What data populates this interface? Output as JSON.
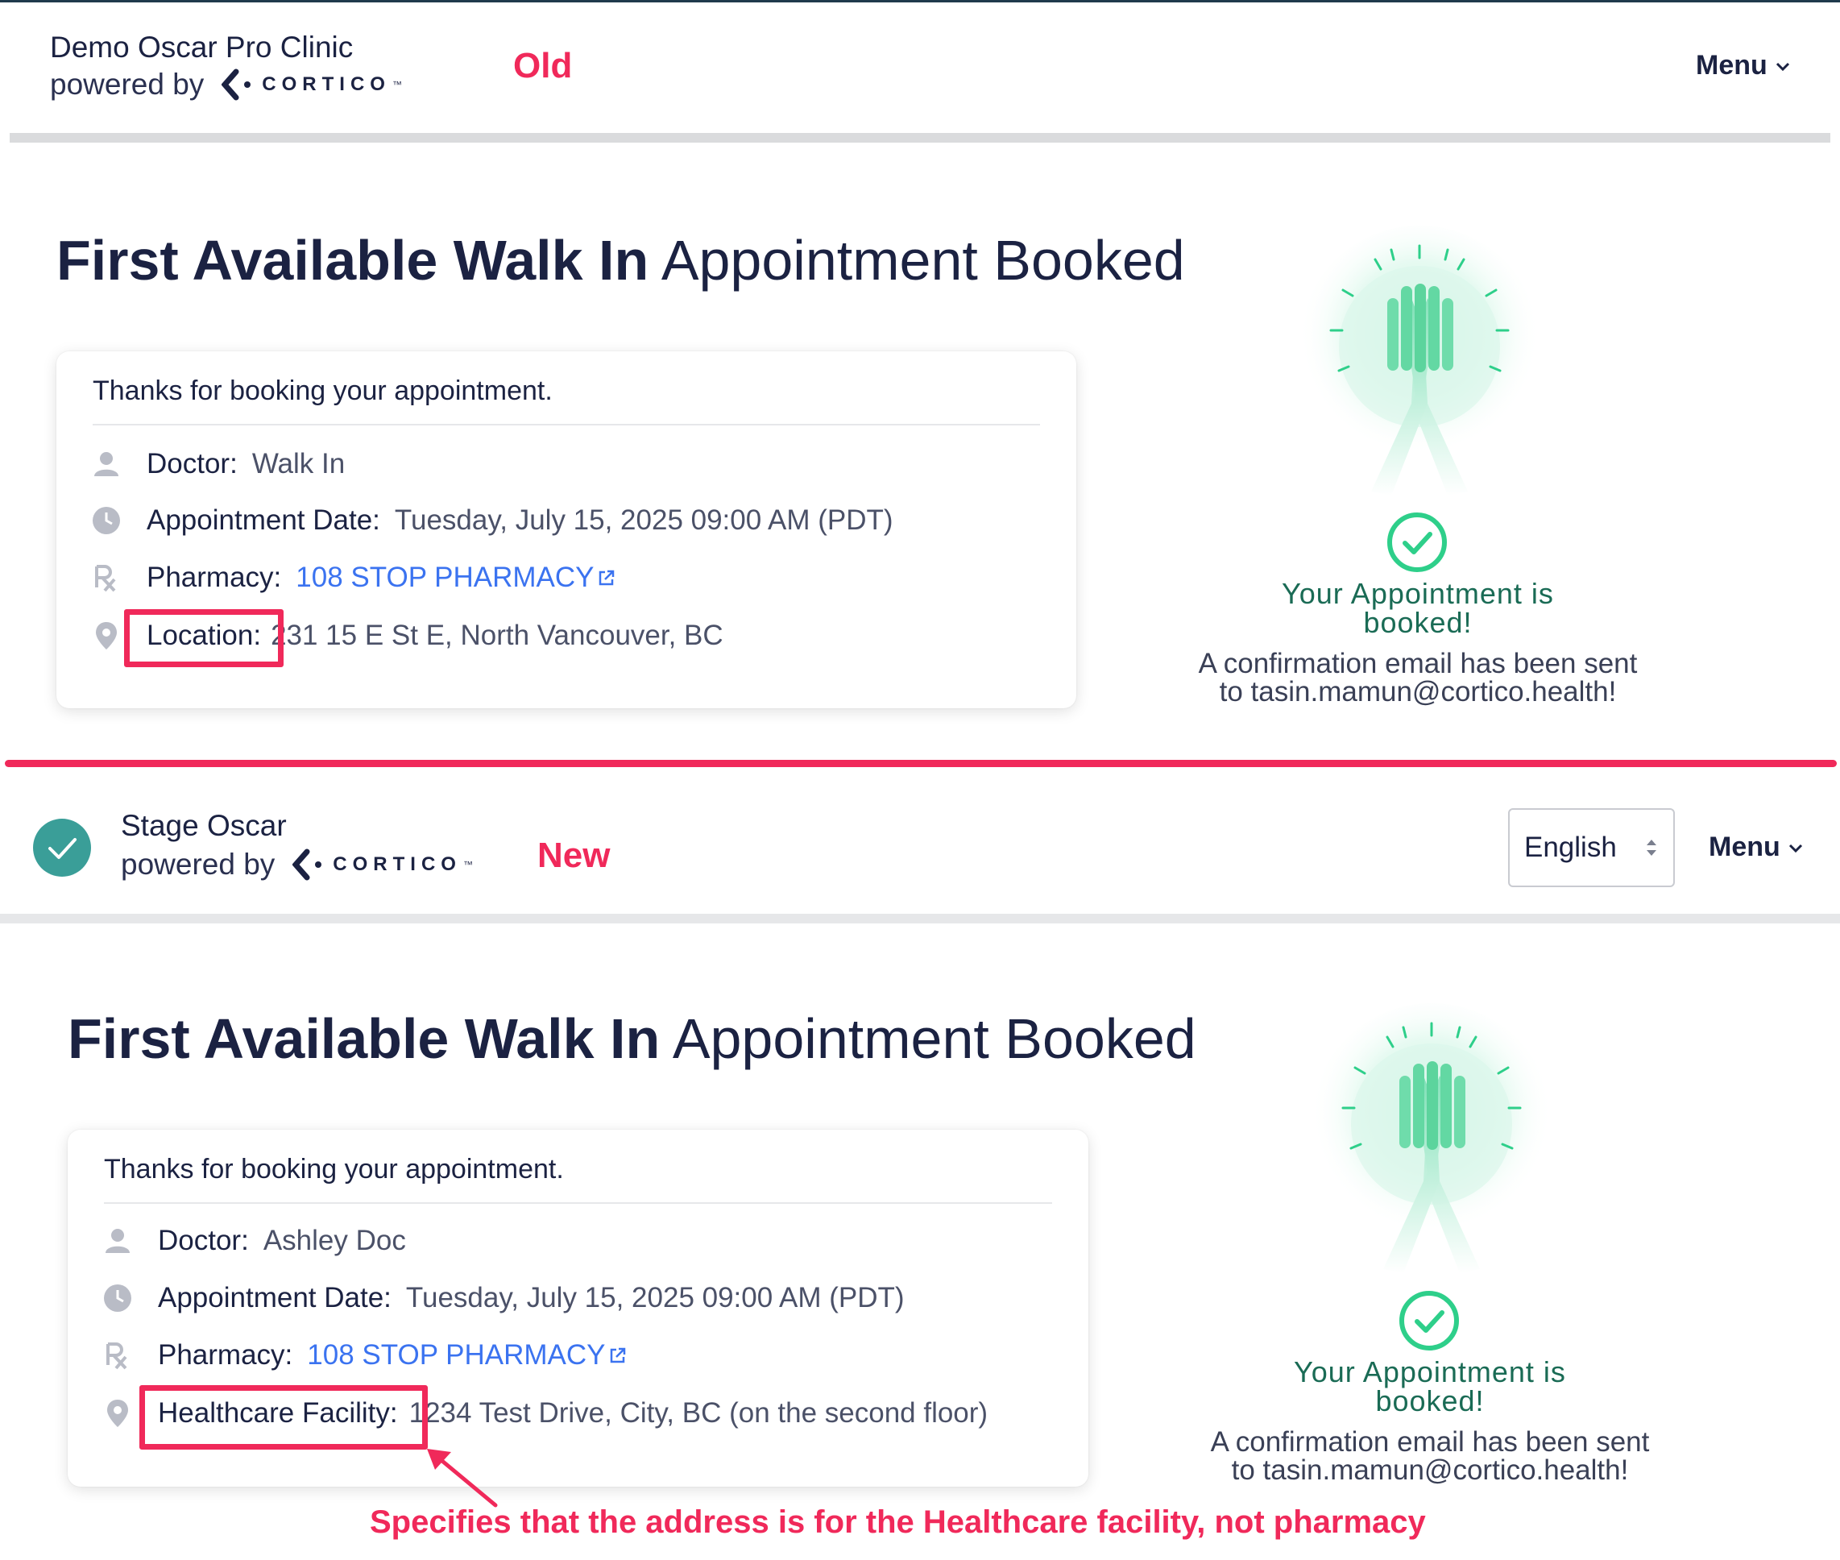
{
  "old": {
    "tag": "Old",
    "header": {
      "clinic_name": "Demo Oscar Pro Clinic",
      "powered_by": "powered by",
      "brand": "CORTICO",
      "tm": "™",
      "menu_label": "Menu"
    },
    "heading": {
      "bold": "First Available Walk In",
      "light": "Appointment Booked"
    },
    "card": {
      "intro": "Thanks for booking your appointment.",
      "rows": [
        {
          "label": "Doctor:",
          "value": "Walk In"
        },
        {
          "label": "Appointment Date:",
          "value": "Tuesday, July 15, 2025 09:00 AM (PDT)"
        },
        {
          "label": "Pharmacy:",
          "value": "108 STOP PHARMACY"
        },
        {
          "label": "Location:",
          "value": "231 15 E St E, North Vancouver, BC"
        }
      ]
    },
    "success": {
      "title_line1": "Your Appointment is",
      "title_line2": "booked!",
      "email_line1": "A confirmation email has been sent",
      "email_line2": "to tasin.mamun@cortico.health!"
    }
  },
  "new": {
    "tag": "New",
    "header": {
      "clinic_name": "Stage Oscar",
      "powered_by": "powered by",
      "brand": "CORTICO",
      "tm": "™",
      "language": "English",
      "menu_label": "Menu"
    },
    "heading": {
      "bold": "First Available Walk In",
      "light": "Appointment Booked"
    },
    "card": {
      "intro": "Thanks for booking your appointment.",
      "rows": [
        {
          "label": "Doctor:",
          "value": "Ashley Doc"
        },
        {
          "label": "Appointment Date:",
          "value": "Tuesday, July 15, 2025 09:00 AM (PDT)"
        },
        {
          "label": "Pharmacy:",
          "value": "108 STOP PHARMACY"
        },
        {
          "label": "Healthcare Facility:",
          "value": "1234 Test Drive, City, BC (on the second floor)"
        }
      ]
    },
    "success": {
      "title_line1": "Your Appointment is",
      "title_line2": "booked!",
      "email_line1": "A confirmation email has been sent",
      "email_line2": "to tasin.mamun@cortico.health!"
    }
  },
  "annotation": {
    "note": "Specifies that the address is for the Healthcare facility, not pharmacy"
  },
  "colors": {
    "highlight": "#f0295a",
    "link": "#3b73f0",
    "success_green": "#2ecf8a",
    "navy": "#1b2242"
  },
  "icons": [
    "person-icon",
    "clock-icon",
    "rx-icon",
    "location-pin-icon",
    "external-link-icon",
    "check-circle-icon",
    "high-five-illustration",
    "chevron-down-icon",
    "cortico-logo-icon",
    "clinic-check-logo"
  ]
}
